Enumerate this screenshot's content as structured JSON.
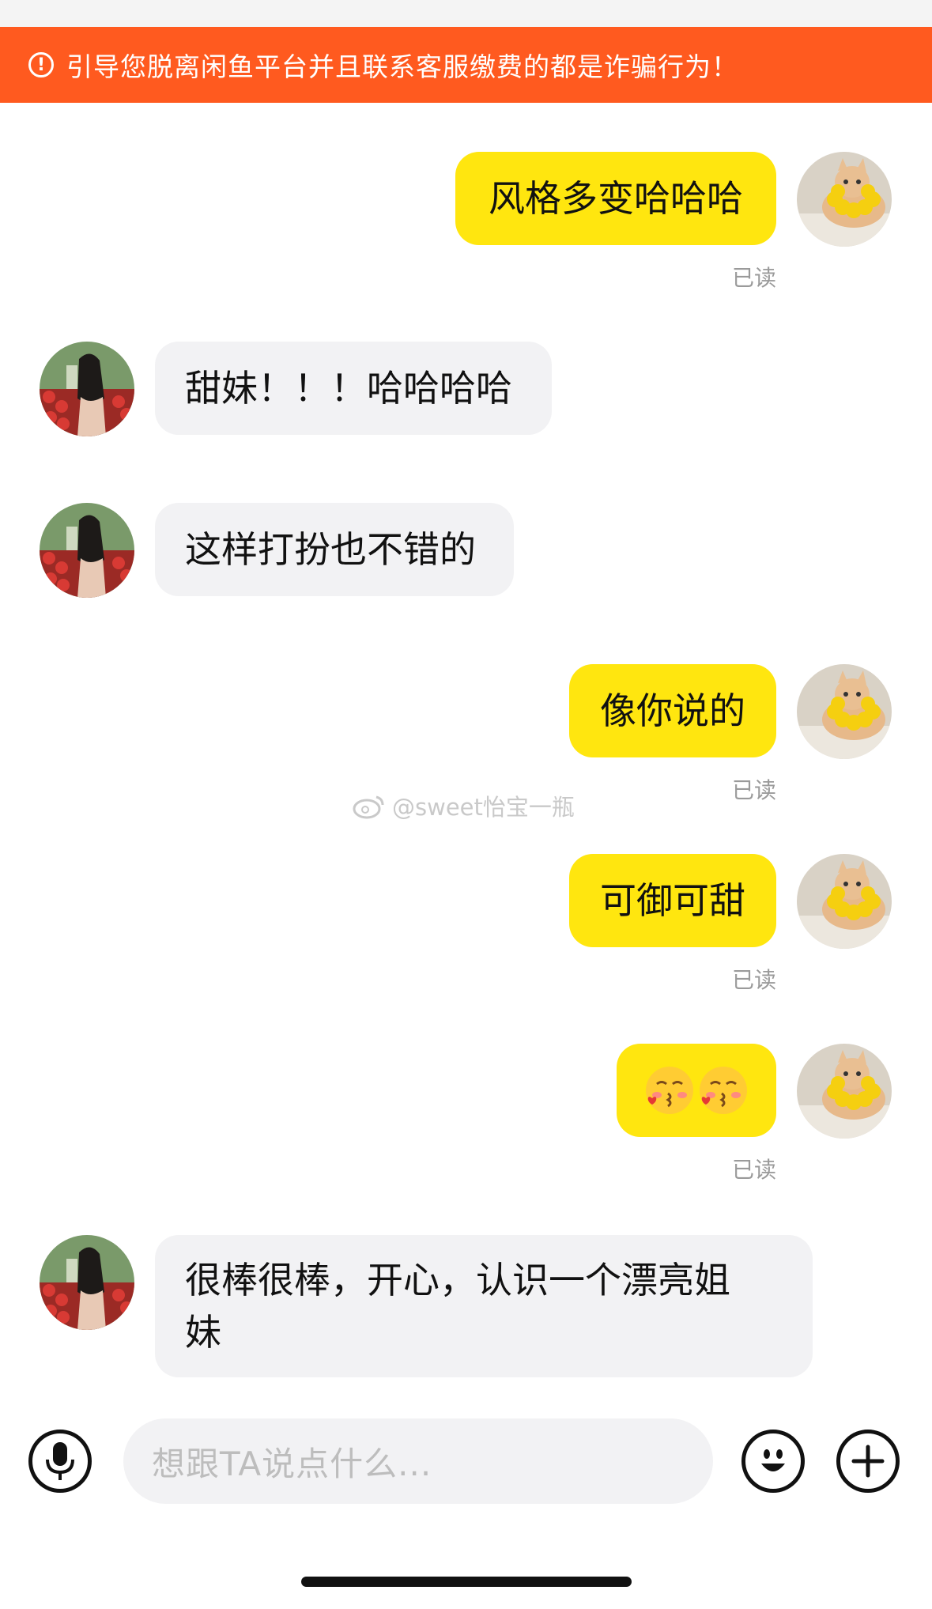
{
  "warning": {
    "icon": "alert-circle-icon",
    "text": "引导您脱离闲鱼平台并且联系客服缴费的都是诈骗行为！"
  },
  "messages": [
    {
      "side": "mine",
      "text": "风格多变哈哈哈",
      "status": "已读",
      "avatar": "cat-avatar"
    },
    {
      "side": "theirs",
      "text": "甜妹！！！哈哈哈哈",
      "avatar": "girl-avatar"
    },
    {
      "side": "theirs",
      "text": "这样打扮也不错的",
      "avatar": "girl-avatar"
    },
    {
      "side": "mine",
      "text": "像你说的",
      "status": "已读",
      "avatar": "cat-avatar"
    },
    {
      "side": "mine",
      "text": "可御可甜",
      "status": "已读",
      "avatar": "cat-avatar"
    },
    {
      "side": "mine",
      "emoji": [
        "kissing-face-icon",
        "kissing-face-icon"
      ],
      "status": "已读",
      "avatar": "cat-avatar"
    },
    {
      "side": "theirs",
      "line1": "很棒很棒，开心，认识一个漂亮姐",
      "line2": "妹",
      "avatar": "girl-avatar"
    }
  ],
  "watermark": {
    "text": "@sweet怡宝一瓶",
    "icon": "weibo-icon"
  },
  "input": {
    "placeholder": "想跟TA说点什么...",
    "voice_icon": "microphone-icon",
    "emoji_icon": "smiley-icon",
    "plus_icon": "plus-icon"
  },
  "colors": {
    "banner": "#ff5a1f",
    "my_bubble": "#ffe60f",
    "their_bubble": "#f2f2f4"
  }
}
